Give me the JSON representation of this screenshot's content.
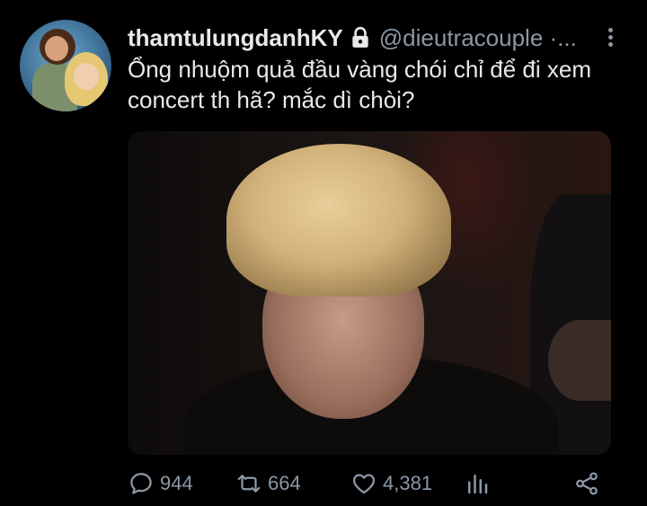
{
  "tweet": {
    "display_name": "thamtulungdanhKY",
    "handle": "@dieutracouple ·...",
    "text": "Ổng nhuộm quả đầu vàng chói chỉ để đi xem concert th hã? mắc dì chòi?",
    "protected_icon": "lock-icon",
    "more_icon": "more-vertical-icon"
  },
  "actions": {
    "reply_count": "944",
    "retweet_count": "664",
    "like_count": "4,381"
  },
  "icons": {
    "reply": "reply-icon",
    "retweet": "retweet-icon",
    "like": "heart-icon",
    "analytics": "analytics-icon",
    "share": "share-icon"
  },
  "colors": {
    "background": "#000000",
    "text_primary": "#e7e9ea",
    "text_secondary": "#8b98a5"
  }
}
